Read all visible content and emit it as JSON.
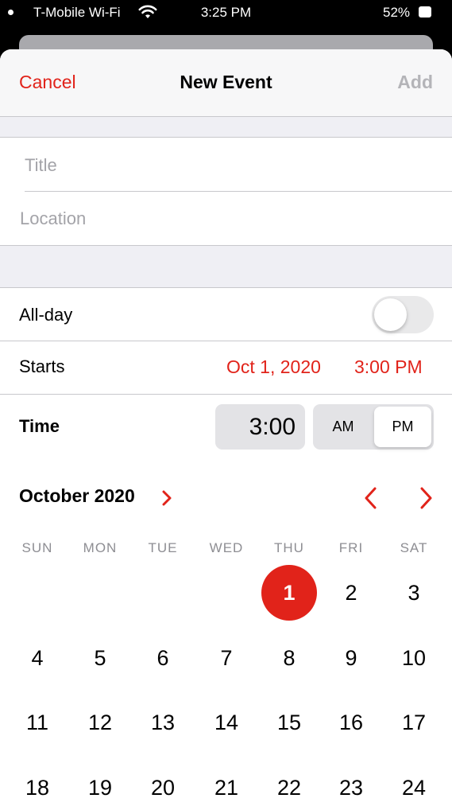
{
  "status_bar": {
    "carrier": "T-Mobile Wi-Fi",
    "time": "3:25 PM",
    "battery": "52%"
  },
  "navbar": {
    "cancel": "Cancel",
    "title": "New Event",
    "add": "Add"
  },
  "form": {
    "title_placeholder": "Title",
    "location_placeholder": "Location",
    "allday_label": "All-day",
    "allday_on": false,
    "starts_label": "Starts",
    "starts_date": "Oct 1, 2020",
    "starts_time": "3:00 PM",
    "time_label": "Time",
    "time_value": "3:00",
    "am_label": "AM",
    "pm_label": "PM",
    "meridiem_selected": "PM"
  },
  "calendar": {
    "month_label": "October 2020",
    "weekdays": [
      "SUN",
      "MON",
      "TUE",
      "WED",
      "THU",
      "FRI",
      "SAT"
    ],
    "weeks": [
      [
        "",
        "",
        "",
        "",
        "1",
        "2",
        "3"
      ],
      [
        "4",
        "5",
        "6",
        "7",
        "8",
        "9",
        "10"
      ],
      [
        "11",
        "12",
        "13",
        "14",
        "15",
        "16",
        "17"
      ],
      [
        "18",
        "19",
        "20",
        "21",
        "22",
        "23",
        "24"
      ]
    ],
    "selected_day": "1"
  },
  "colors": {
    "accent": "#e1231a",
    "disabled": "#b4b4b8",
    "group_background": "#efeff4"
  }
}
